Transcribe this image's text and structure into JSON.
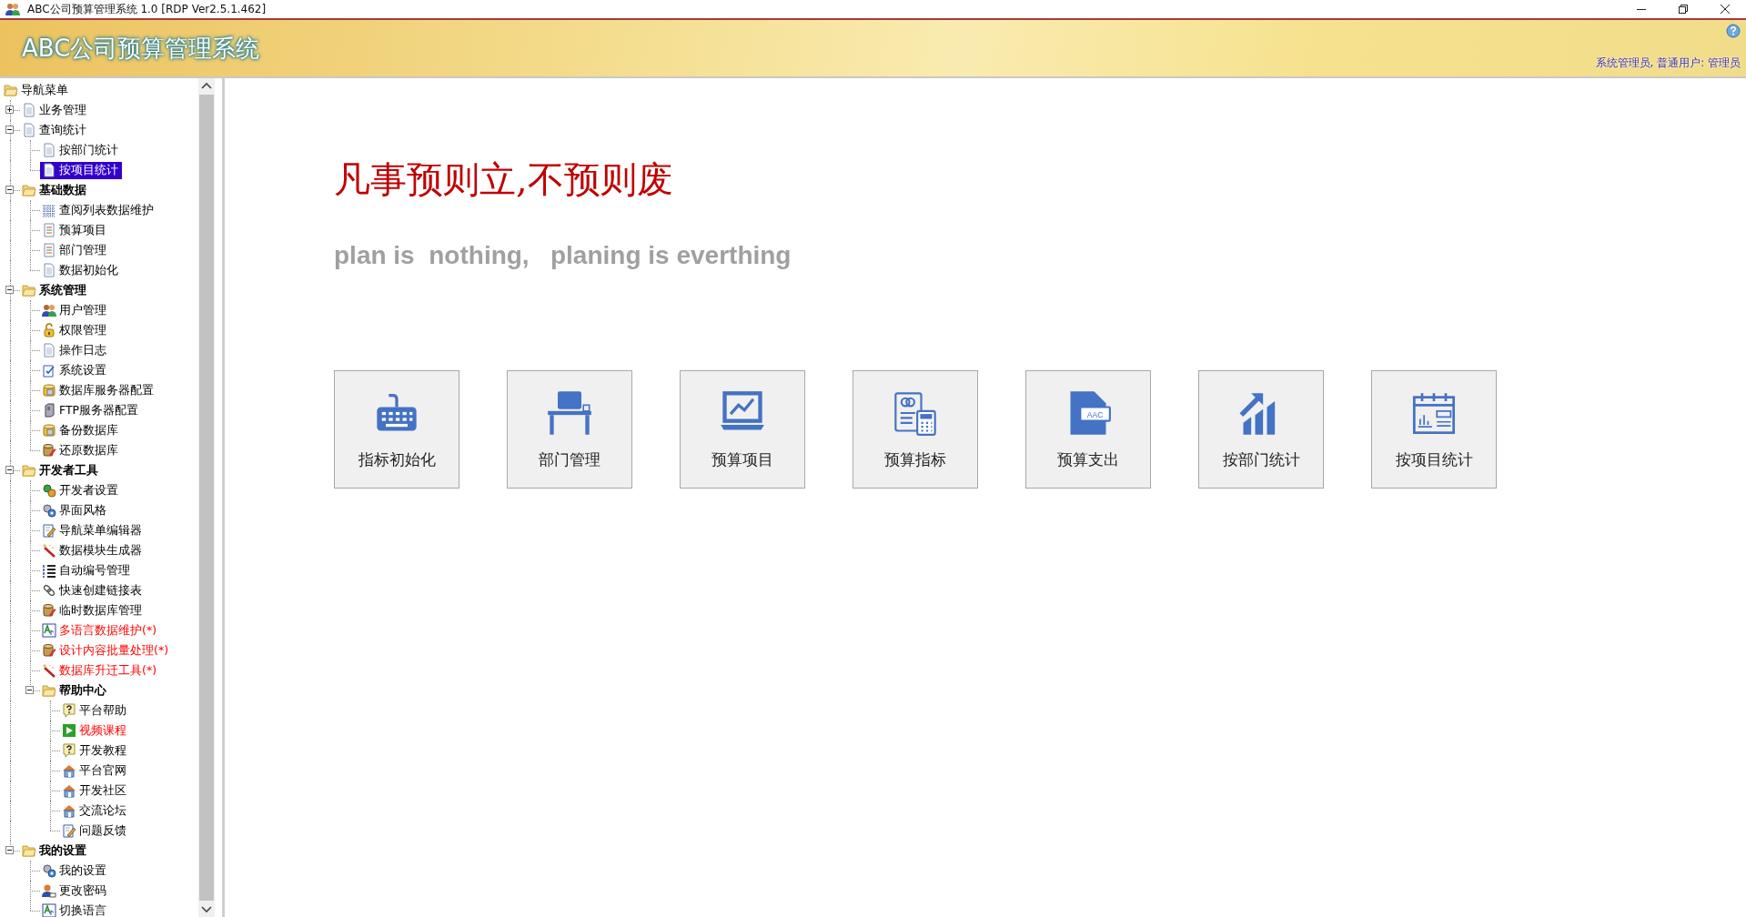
{
  "window": {
    "title": "ABC公司预算管理系统 1.0 [RDP Ver2.5.1.462]"
  },
  "header": {
    "app_title": "ABC公司预算管理系统",
    "user_info": "系统管理员, 普通用户: 管理员"
  },
  "tree": {
    "label": "导航菜单",
    "children": [
      {
        "label": "业务管理",
        "kind": "doc",
        "selected": false,
        "expanded": false
      },
      {
        "label": "查询统计",
        "kind": "doc",
        "selected": false,
        "expanded": true,
        "children": [
          {
            "label": "按部门统计",
            "kind": "doc",
            "selected": false
          },
          {
            "label": "按项目统计",
            "kind": "doc",
            "selected": true
          }
        ]
      },
      {
        "label": "基础数据",
        "kind": "folder",
        "selected": false,
        "expanded": true,
        "children": [
          {
            "label": "查阅列表数据维护",
            "kind": "grid",
            "selected": false
          },
          {
            "label": "预算项目",
            "kind": "list-doc",
            "selected": false
          },
          {
            "label": "部门管理",
            "kind": "list-doc",
            "selected": false
          },
          {
            "label": "数据初始化",
            "kind": "doc",
            "selected": false
          }
        ]
      },
      {
        "label": "系统管理",
        "kind": "folder",
        "selected": false,
        "expanded": true,
        "children": [
          {
            "label": "用户管理",
            "kind": "users",
            "selected": false
          },
          {
            "label": "权限管理",
            "kind": "lock",
            "selected": false
          },
          {
            "label": "操作日志",
            "kind": "doc",
            "selected": false
          },
          {
            "label": "系统设置",
            "kind": "check-doc",
            "selected": false
          },
          {
            "label": "数据库服务器配置",
            "kind": "database",
            "selected": false
          },
          {
            "label": "FTP服务器配置",
            "kind": "server",
            "selected": false
          },
          {
            "label": "备份数据库",
            "kind": "database",
            "selected": false
          },
          {
            "label": "还原数据库",
            "kind": "db-edit",
            "selected": false
          }
        ]
      },
      {
        "label": "开发者工具",
        "kind": "folder",
        "selected": false,
        "expanded": true,
        "children": [
          {
            "label": "开发者设置",
            "kind": "dev-gears",
            "selected": false
          },
          {
            "label": "界面风格",
            "kind": "gears",
            "selected": false
          },
          {
            "label": "导航菜单编辑器",
            "kind": "edit",
            "selected": false
          },
          {
            "label": "数据模块生成器",
            "kind": "wand",
            "selected": false
          },
          {
            "label": "自动编号管理",
            "kind": "numbered-list",
            "selected": false
          },
          {
            "label": "快速创建链接表",
            "kind": "link",
            "selected": false
          },
          {
            "label": "临时数据库管理",
            "kind": "db-edit",
            "selected": false
          },
          {
            "label": "多语言数据维护(*)",
            "kind": "language",
            "selected": false,
            "color": "#ff0000"
          },
          {
            "label": "设计内容批量处理(*)",
            "kind": "db-edit",
            "selected": false,
            "color": "#ff0000"
          },
          {
            "label": "数据库升迁工具(*)",
            "kind": "wand",
            "selected": false,
            "color": "#ff0000"
          },
          {
            "label": "帮助中心",
            "kind": "folder",
            "selected": false,
            "expanded": true,
            "children": [
              {
                "label": "平台帮助",
                "kind": "help",
                "selected": false
              },
              {
                "label": "视频课程",
                "kind": "play",
                "selected": false,
                "color": "#ff0000"
              },
              {
                "label": "开发教程",
                "kind": "help",
                "selected": false
              },
              {
                "label": "平台官网",
                "kind": "home",
                "selected": false
              },
              {
                "label": "开发社区",
                "kind": "home",
                "selected": false
              },
              {
                "label": "交流论坛",
                "kind": "home",
                "selected": false
              },
              {
                "label": "问题反馈",
                "kind": "edit",
                "selected": false
              }
            ]
          }
        ]
      },
      {
        "label": "我的设置",
        "kind": "folder",
        "selected": false,
        "expanded": true,
        "children": [
          {
            "label": "我的设置",
            "kind": "gears",
            "selected": false
          },
          {
            "label": "更改密码",
            "kind": "user",
            "selected": false
          },
          {
            "label": "切换语言",
            "kind": "language",
            "selected": false
          }
        ]
      }
    ]
  },
  "main": {
    "motto": "凡事预则立,不预则废",
    "slogan": "plan is  nothing,   planing is everthing",
    "tiles": [
      {
        "label": "指标初始化",
        "kind": "keyboard"
      },
      {
        "label": "部门管理",
        "kind": "desk"
      },
      {
        "label": "预算项目",
        "kind": "monitor-chart"
      },
      {
        "label": "预算指标",
        "kind": "calculator"
      },
      {
        "label": "预算支出",
        "kind": "file",
        "badge": "AAC"
      },
      {
        "label": "按部门统计",
        "kind": "growth-chart"
      },
      {
        "label": "按项目统计",
        "kind": "calendar-chart"
      }
    ]
  }
}
